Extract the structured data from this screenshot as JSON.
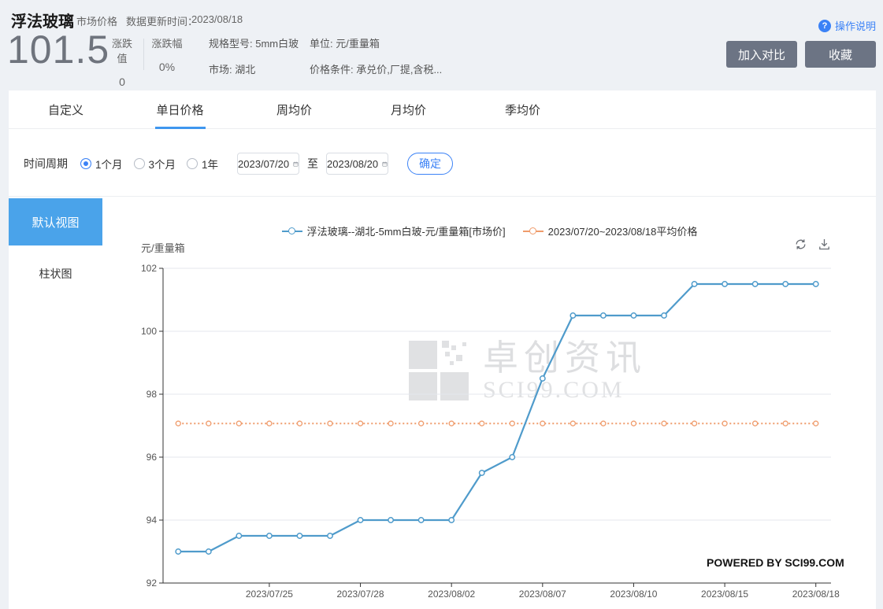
{
  "header": {
    "title": "浮法玻璃",
    "subtitle": "市场价格",
    "update_label": "数据更新时间：",
    "update_value": "2023/08/18",
    "price": "101.5",
    "change_label": "涨跌值",
    "change_value": "0",
    "change_pct_label": "涨跌幅",
    "change_pct_value": "0%",
    "spec_line": "规格型号: 5mm白玻",
    "market_line": "市场: 湖北",
    "unit_line": "单位: 元/重量箱",
    "condition_line": "价格条件: 承兑价,厂提,含税...",
    "help_icon": "question-mark-icon",
    "help_label": "操作说明",
    "compare_button": "加入对比",
    "favorite_button": "收藏"
  },
  "tabs": [
    {
      "label": "自定义",
      "active": false
    },
    {
      "label": "单日价格",
      "active": true
    },
    {
      "label": "周均价",
      "active": false
    },
    {
      "label": "月均价",
      "active": false
    },
    {
      "label": "季均价",
      "active": false
    }
  ],
  "filter": {
    "period_label": "时间周期",
    "options": [
      {
        "label": "1个月",
        "selected": true
      },
      {
        "label": "3个月",
        "selected": false
      },
      {
        "label": "1年",
        "selected": false
      }
    ],
    "date_from": "2023/07/20",
    "to_label": "至",
    "date_to": "2023/08/20",
    "calendar_icon": "calendar-icon",
    "confirm_button": "确定"
  },
  "sidebar": {
    "default_view": "默认视图",
    "bar_view": "柱状图"
  },
  "chart_header": {
    "legend": [
      {
        "name": "浮法玻璃--湖北-5mm白玻-元/重量箱[市场价]",
        "color": "#4f9bcb"
      },
      {
        "name": "2023/07/20~2023/08/18平均价格",
        "color": "#ef9b6b"
      }
    ],
    "refresh_icon": "refresh-icon",
    "download_icon": "download-icon"
  },
  "chart_data": {
    "type": "line",
    "ylabel": "元/重量箱",
    "ylim": [
      92,
      102
    ],
    "y_ticks": [
      92,
      94,
      96,
      98,
      100,
      102
    ],
    "grid": true,
    "legend_position": "top-center",
    "x": [
      "2023/07/20",
      "2023/07/21",
      "2023/07/24",
      "2023/07/25",
      "2023/07/26",
      "2023/07/27",
      "2023/07/28",
      "2023/07/31",
      "2023/08/01",
      "2023/08/02",
      "2023/08/03",
      "2023/08/04",
      "2023/08/07",
      "2023/08/08",
      "2023/08/09",
      "2023/08/10",
      "2023/08/11",
      "2023/08/14",
      "2023/08/15",
      "2023/08/16",
      "2023/08/17",
      "2023/08/18"
    ],
    "x_tick_labels": [
      "2023/07/25",
      "2023/07/28",
      "2023/08/02",
      "2023/08/07",
      "2023/08/10",
      "2023/08/15",
      "2023/08/18"
    ],
    "series": [
      {
        "name": "浮法玻璃--湖北-5mm白玻-元/重量箱[市场价]",
        "type": "line",
        "color": "#4f9bcb",
        "values": [
          93,
          93,
          93.5,
          93.5,
          93.5,
          93.5,
          94,
          94,
          94,
          94,
          95.5,
          96,
          98.5,
          100.5,
          100.5,
          100.5,
          100.5,
          101.5,
          101.5,
          101.5,
          101.5,
          101.5
        ]
      },
      {
        "name": "2023/07/20~2023/08/18平均价格",
        "type": "dotted-average-line",
        "color": "#ef9b6b",
        "average_value": 97.07
      }
    ],
    "watermark": {
      "line1": "卓创资讯",
      "line2": "SCI99.COM"
    },
    "powered_by": "POWERED BY SCI99.COM"
  },
  "colors": {
    "accent_blue": "#3b82f6",
    "tab_underline": "#3f97ef",
    "sidebar_active": "#4aa3ea",
    "series_blue": "#4f9bcb",
    "series_orange": "#ef9b6b",
    "gray_button": "#6c7484",
    "page_bg": "#eef1f5"
  }
}
